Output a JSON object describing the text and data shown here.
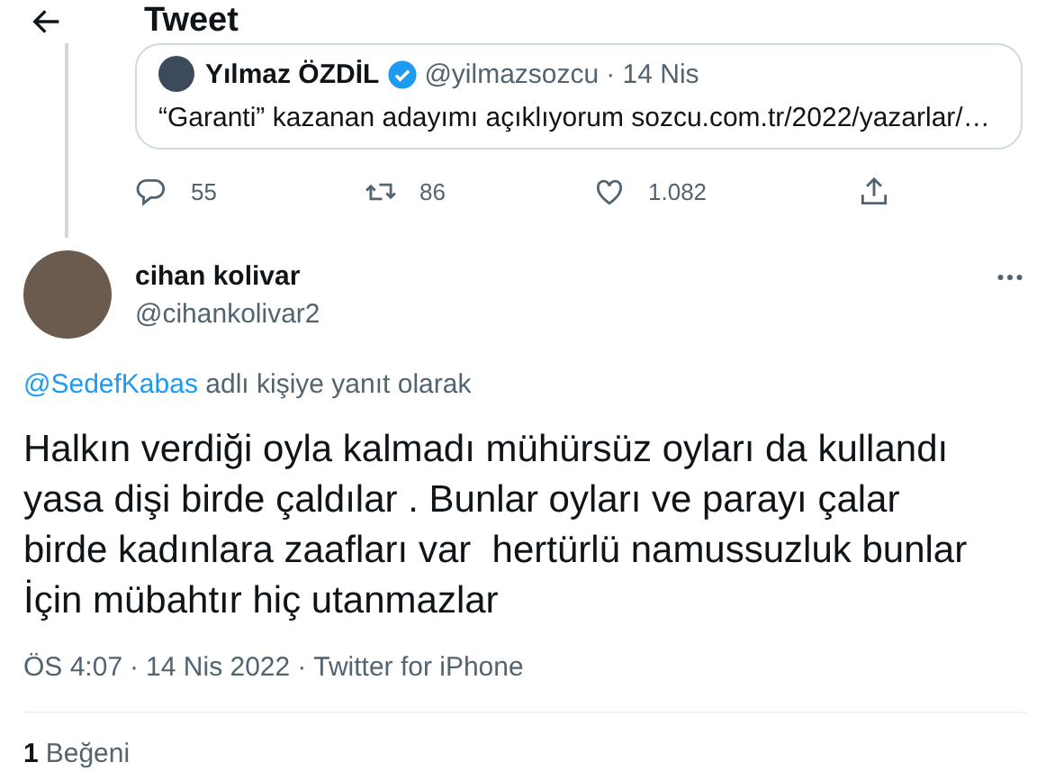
{
  "header": {
    "title": "Tweet"
  },
  "quoted_tweet": {
    "author": "Yılmaz ÖZDİL",
    "verified": true,
    "handle": "@yilmazsozcu",
    "date": "· 14 Nis",
    "text": "“Garanti” kazanan adayımı açıklıyorum sozcu.com.tr/2022/yazarlar/…"
  },
  "parent_actions": [
    {
      "kind": "reply",
      "count": "55"
    },
    {
      "kind": "retweet",
      "count": "86"
    },
    {
      "kind": "like",
      "count": "1.082"
    },
    {
      "kind": "share"
    }
  ],
  "tweet": {
    "author": "cihan kolivar",
    "handle": "@cihankolivar2",
    "reply_to": {
      "mention": "@SedefKabas",
      "text": "adlı kişiye yanıt olarak"
    },
    "text": "Halkın verdiği oyla kalmadı mühürsüz oyları da kullandı yasa dişi birde çaldılar . Bunlar oyları ve parayı çalar birde kadınlara zaafları var  hertürlü namussuzluk bunlar İçin mübahtır hiç utanmazlar",
    "meta": [
      "ÖS 4:07",
      "14 Nis 2022",
      "Twitter for iPhone"
    ],
    "meta_separator": "·",
    "likes": {
      "count": "1",
      "label": "Beğeni"
    }
  }
}
